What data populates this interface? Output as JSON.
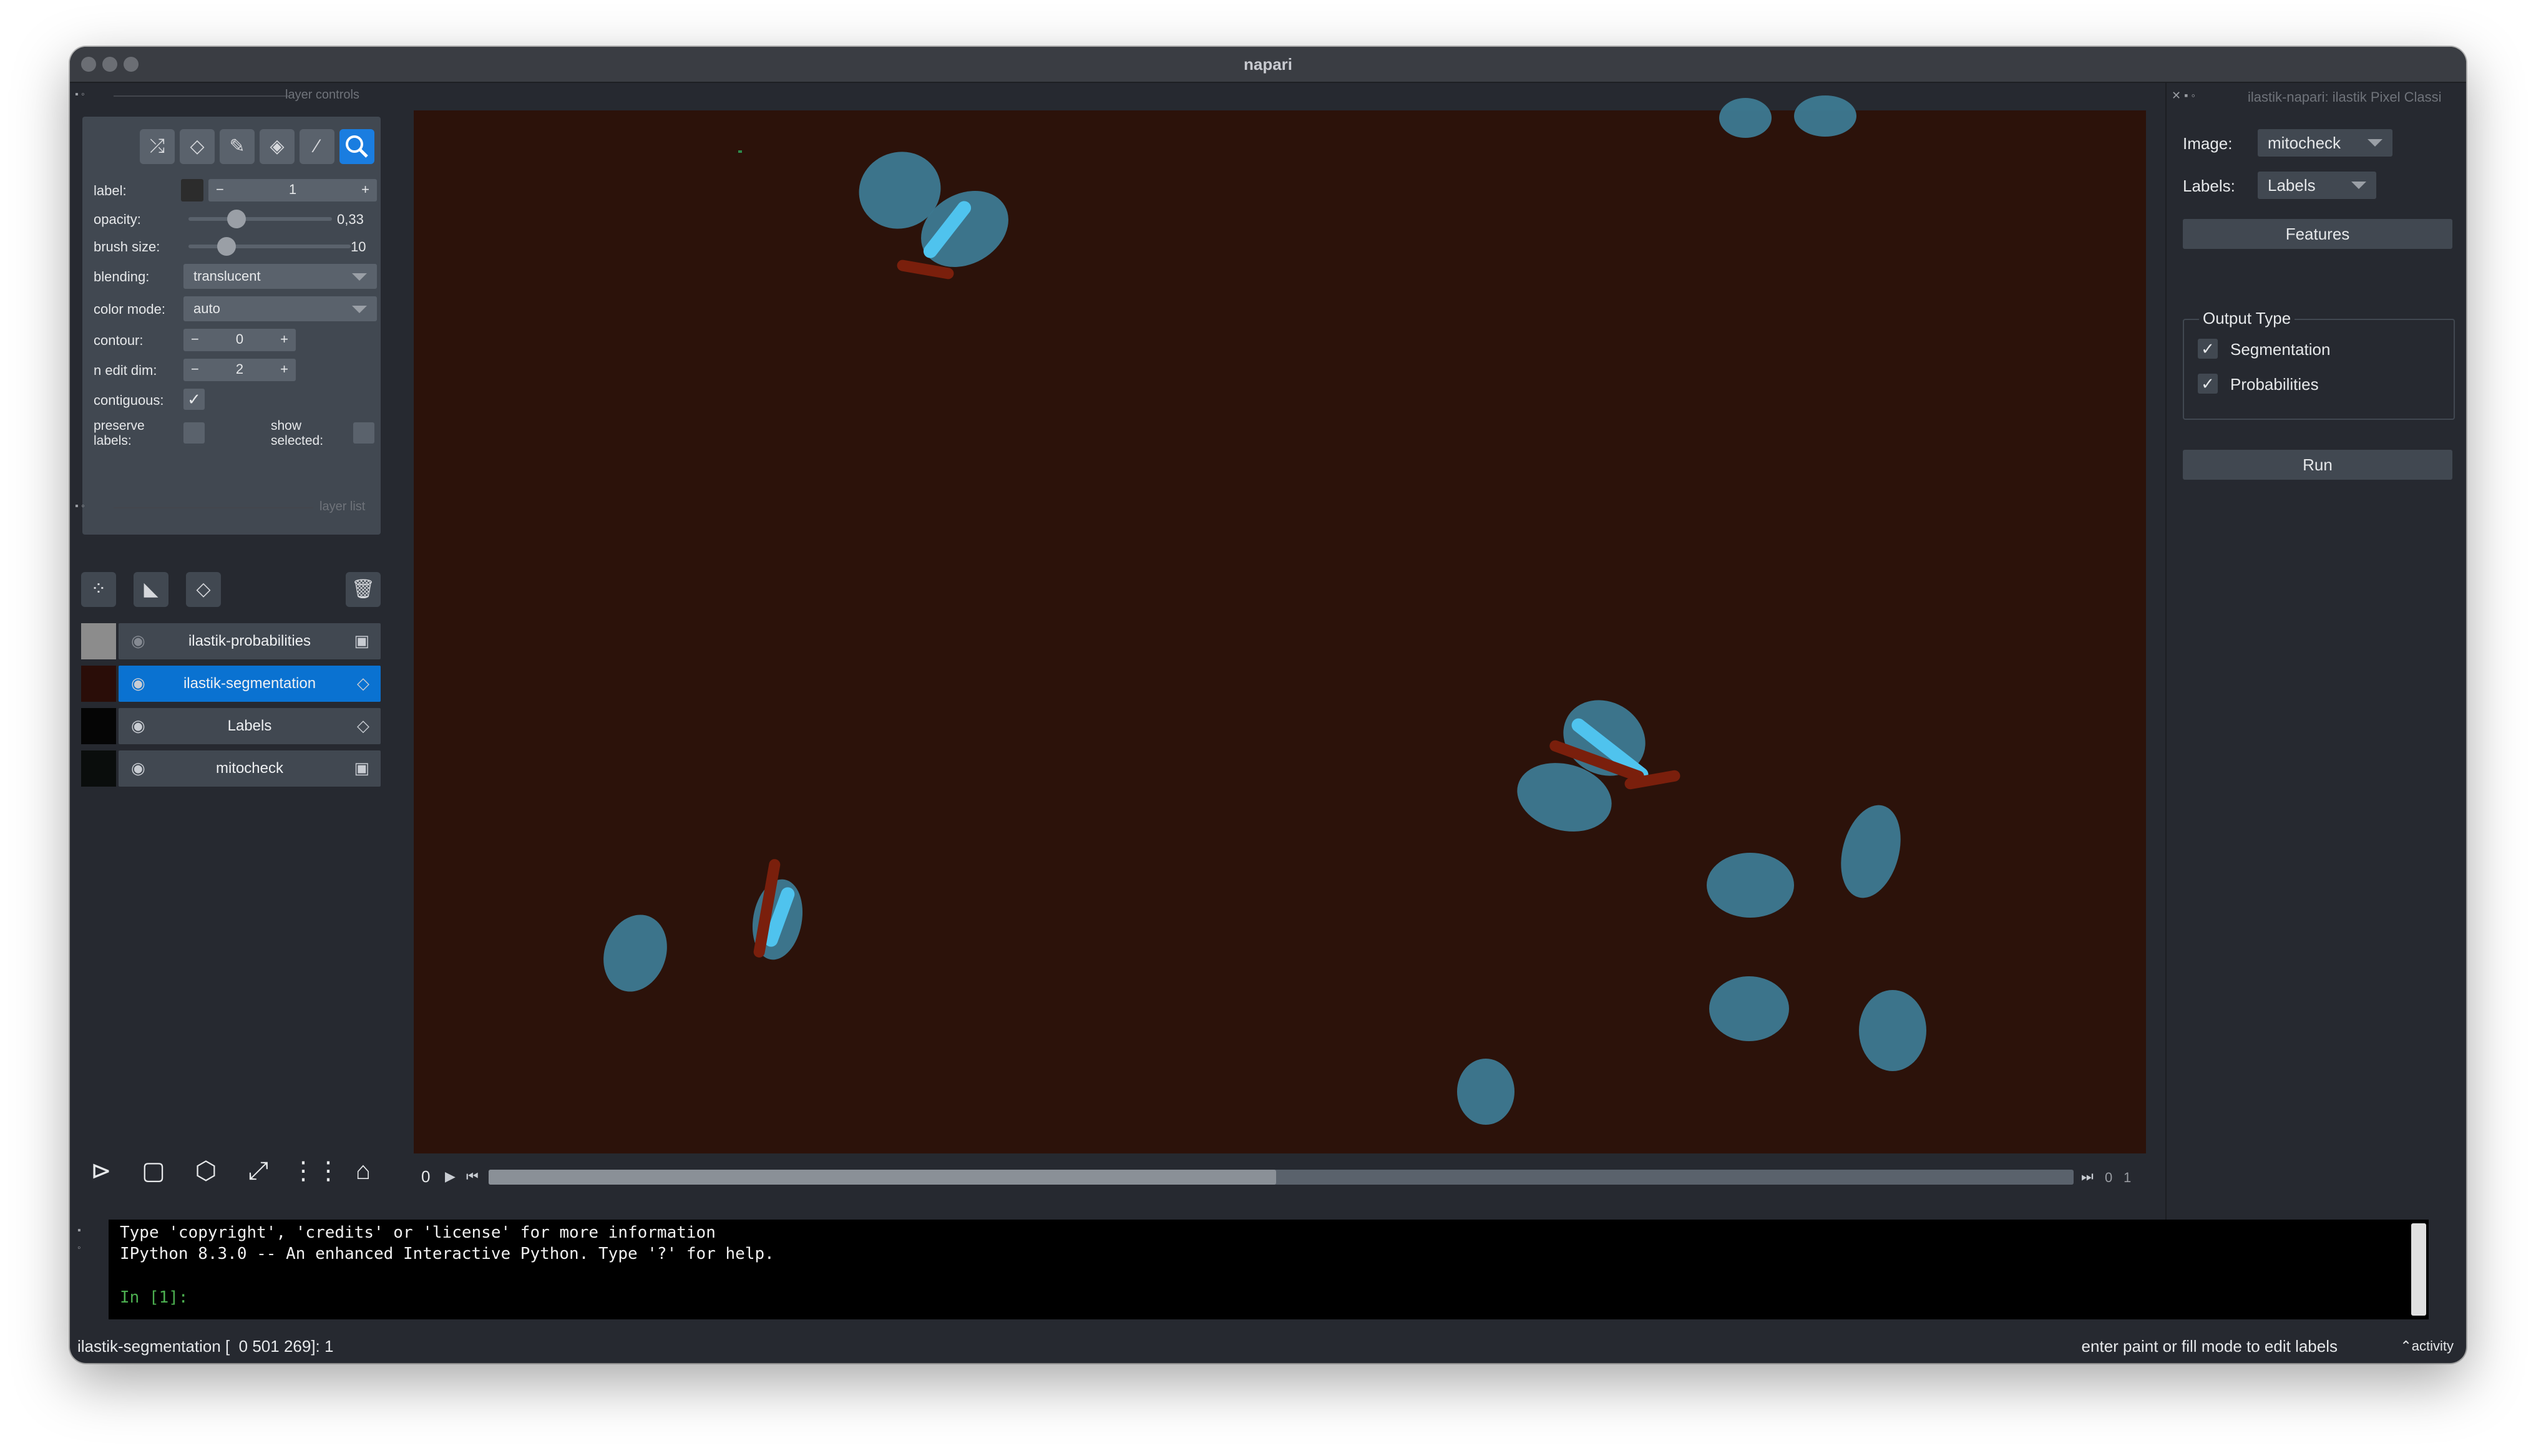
{
  "window": {
    "title": "napari"
  },
  "left_dock": {
    "controls_title": "layer controls",
    "layerlist_title": "layer list",
    "tools": [
      {
        "name": "shuffle-colors-icon"
      },
      {
        "name": "eraser-icon"
      },
      {
        "name": "paint-brush-icon"
      },
      {
        "name": "fill-bucket-icon"
      },
      {
        "name": "color-picker-icon"
      },
      {
        "name": "pan-zoom-icon",
        "active": true
      }
    ],
    "controls": {
      "label": {
        "label": "label:",
        "value": "1",
        "minus": "−",
        "plus": "+"
      },
      "opacity": {
        "label": "opacity:",
        "value": "0,33",
        "level": 0.33
      },
      "brush_size": {
        "label": "brush size:",
        "value": "10",
        "level": 0.26
      },
      "blending": {
        "label": "blending:",
        "value": "translucent"
      },
      "color_mode": {
        "label": "color mode:",
        "value": "auto"
      },
      "contour": {
        "label": "contour:",
        "value": "0",
        "minus": "−",
        "plus": "+"
      },
      "n_edit_dim": {
        "label": "n edit dim:",
        "value": "2",
        "minus": "−",
        "plus": "+"
      },
      "contiguous": {
        "label": "contiguous:",
        "checked": true,
        "mark": "✓"
      },
      "preserve_labels": {
        "label_line1": "preserve",
        "label_line2": "labels:",
        "checked": false
      },
      "show_selected": {
        "label_line1": "show",
        "label_line2": "selected:",
        "checked": false
      }
    },
    "layers": [
      {
        "name": "ilastik-probabilities",
        "visible": false,
        "type_icon": "image-layer-icon",
        "selected": false
      },
      {
        "name": "ilastik-segmentation",
        "visible": true,
        "type_icon": "labels-layer-icon",
        "selected": true
      },
      {
        "name": "Labels",
        "visible": true,
        "type_icon": "labels-layer-icon",
        "selected": false
      },
      {
        "name": "mitocheck",
        "visible": true,
        "type_icon": "image-layer-icon",
        "selected": false
      }
    ]
  },
  "dims": {
    "left_value": "0",
    "right_value": "0",
    "max_value": "1",
    "fill": 0.44
  },
  "right_dock": {
    "title": "ilastik-napari: ilastik Pixel Classi",
    "image_label": "Image:",
    "image_value": "mitocheck",
    "labels_label": "Labels:",
    "labels_value": "Labels",
    "features_button": "Features",
    "output_type_title": "Output Type",
    "segmentation_label": "Segmentation",
    "segmentation_checked": true,
    "probabilities_label": "Probabilities",
    "probabilities_checked": true,
    "run_button": "Run"
  },
  "console": {
    "line1": "Type 'copyright', 'credits' or 'license' for more information",
    "line2": "IPython 8.3.0 -- An enhanced Interactive Python. Type '?' for help.",
    "prompt": "In [1]:"
  },
  "status": {
    "left": "ilastik-segmentation [  0 501 269]: 1",
    "right": "enter paint or fill mode to edit labels",
    "activity": "activity"
  },
  "colors": {
    "accent": "#0a72d1",
    "canvas_bg": "#2c120a",
    "cell": "#3d7a92",
    "label_blue": "#4fc3ee",
    "label_red": "#7a1f0c"
  }
}
